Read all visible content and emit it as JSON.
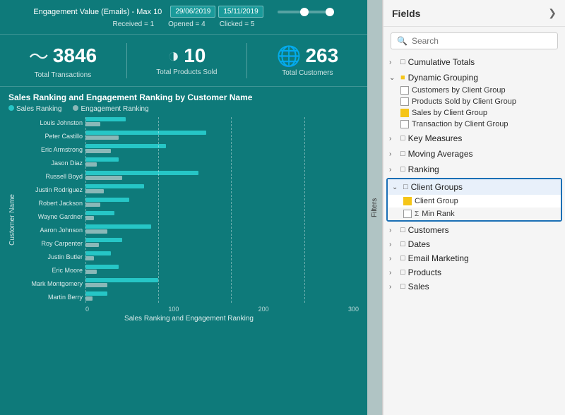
{
  "dashboard": {
    "engagement_label": "Engagement Value (Emails) - Max 10",
    "received": "Received = 1",
    "opened": "Opened = 4",
    "clicked": "Clicked = 5",
    "date1": "29/06/2019",
    "date2": "15/11/2019",
    "stats": [
      {
        "icon": "〜",
        "value": "3846",
        "label": "Total Transactions"
      },
      {
        "icon": "◑",
        "value": "10",
        "label": "Total Products Sold"
      },
      {
        "icon": "🌐",
        "value": "263",
        "label": "Total Customers"
      }
    ],
    "chart_title": "Sales Ranking and Engagement Ranking by Customer Name",
    "legend": [
      "Sales Ranking",
      "Engagement Ranking"
    ],
    "y_axis_label": "Customer Name",
    "x_axis_label": "Sales Ranking and Engagement Ranking",
    "x_axis_values": [
      "0",
      "100",
      "200",
      "300"
    ],
    "customers": [
      {
        "name": "Louis Johnston",
        "sales": 55,
        "engagement": 20
      },
      {
        "name": "Peter Castillo",
        "sales": 165,
        "engagement": 45
      },
      {
        "name": "Eric Armstrong",
        "sales": 110,
        "engagement": 35
      },
      {
        "name": "Jason Diaz",
        "sales": 45,
        "engagement": 15
      },
      {
        "name": "Russell Boyd",
        "sales": 155,
        "engagement": 50
      },
      {
        "name": "Justin Rodriguez",
        "sales": 80,
        "engagement": 25
      },
      {
        "name": "Robert Jackson",
        "sales": 60,
        "engagement": 20
      },
      {
        "name": "Wayne Gardner",
        "sales": 40,
        "engagement": 12
      },
      {
        "name": "Aaron Johnson",
        "sales": 90,
        "engagement": 30
      },
      {
        "name": "Roy Carpenter",
        "sales": 50,
        "engagement": 18
      },
      {
        "name": "Justin Butler",
        "sales": 35,
        "engagement": 12
      },
      {
        "name": "Eric Moore",
        "sales": 45,
        "engagement": 15
      },
      {
        "name": "Mark Montgomery",
        "sales": 100,
        "engagement": 30
      },
      {
        "name": "Martin Berry",
        "sales": 30,
        "engagement": 10
      }
    ]
  },
  "filters": {
    "label": "Filters"
  },
  "fields": {
    "title": "Fields",
    "search_placeholder": "Search",
    "groups": [
      {
        "id": "cumulative-totals",
        "label": "Cumulative Totals",
        "expanded": false,
        "items": []
      },
      {
        "id": "dynamic-grouping",
        "label": "Dynamic Grouping",
        "expanded": true,
        "items": [
          {
            "label": "Customers by Client Group",
            "checked": false,
            "type": "field"
          },
          {
            "label": "Products Sold by Client Group",
            "checked": false,
            "type": "field"
          },
          {
            "label": "Sales by Client Group",
            "checked": true,
            "type": "measure"
          },
          {
            "label": "Transaction by Client Group",
            "checked": false,
            "type": "field"
          }
        ]
      },
      {
        "id": "key-measures",
        "label": "Key Measures",
        "expanded": false,
        "items": []
      },
      {
        "id": "moving-averages",
        "label": "Moving Averages",
        "expanded": false,
        "items": []
      },
      {
        "id": "ranking",
        "label": "Ranking",
        "expanded": false,
        "items": []
      }
    ],
    "client_groups": {
      "label": "Client Groups",
      "items": [
        {
          "label": "Client Group",
          "checked": true,
          "type": "measure"
        },
        {
          "label": "Min Rank",
          "type": "sigma"
        }
      ]
    },
    "bottom_groups": [
      {
        "label": "Customers"
      },
      {
        "label": "Dates"
      },
      {
        "label": "Email Marketing"
      },
      {
        "label": "Products"
      },
      {
        "label": "Sales"
      }
    ]
  }
}
